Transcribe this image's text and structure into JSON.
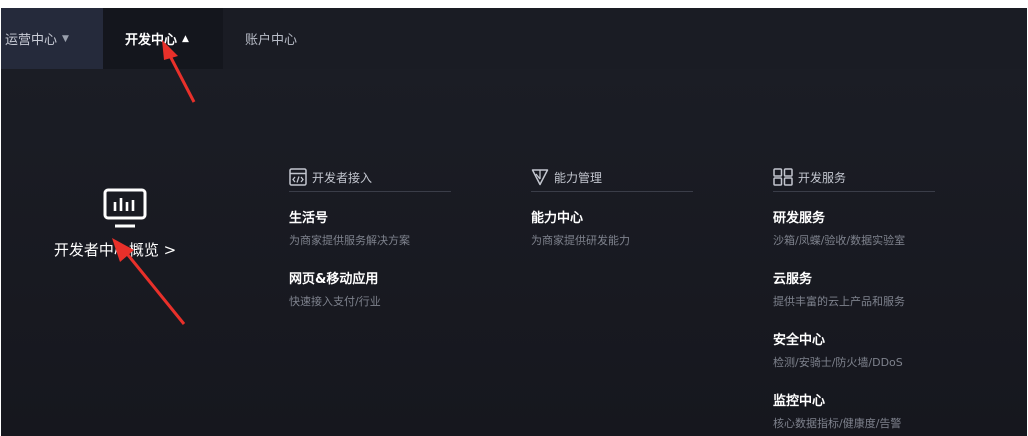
{
  "nav": {
    "tabs": [
      {
        "label": "运营中心"
      },
      {
        "label": "开发中心"
      },
      {
        "label": "账户中心"
      }
    ]
  },
  "overview": {
    "label": "开发者中心概览 >"
  },
  "columns": [
    {
      "title": "开发者接入",
      "icon": "developer-code-icon",
      "items": [
        {
          "title": "生活号",
          "desc": "为商家提供服务解决方案"
        },
        {
          "title": "网页&移动应用",
          "desc": "快速接入支付/行业"
        }
      ]
    },
    {
      "title": "能力管理",
      "icon": "capability-triangle-icon",
      "items": [
        {
          "title": "能力中心",
          "desc": "为商家提供研发能力"
        }
      ]
    },
    {
      "title": "开发服务",
      "icon": "grid-icon",
      "items": [
        {
          "title": "研发服务",
          "desc": "沙箱/凤蝶/验收/数据实验室"
        },
        {
          "title": "云服务",
          "desc": "提供丰富的云上产品和服务"
        },
        {
          "title": "安全中心",
          "desc": "检测/安骑士/防火墙/DDoS"
        },
        {
          "title": "监控中心",
          "desc": "核心数据指标/健康度/告警"
        }
      ]
    }
  ],
  "colors": {
    "background": "#181a22",
    "accent_arrow": "#e8302a"
  }
}
